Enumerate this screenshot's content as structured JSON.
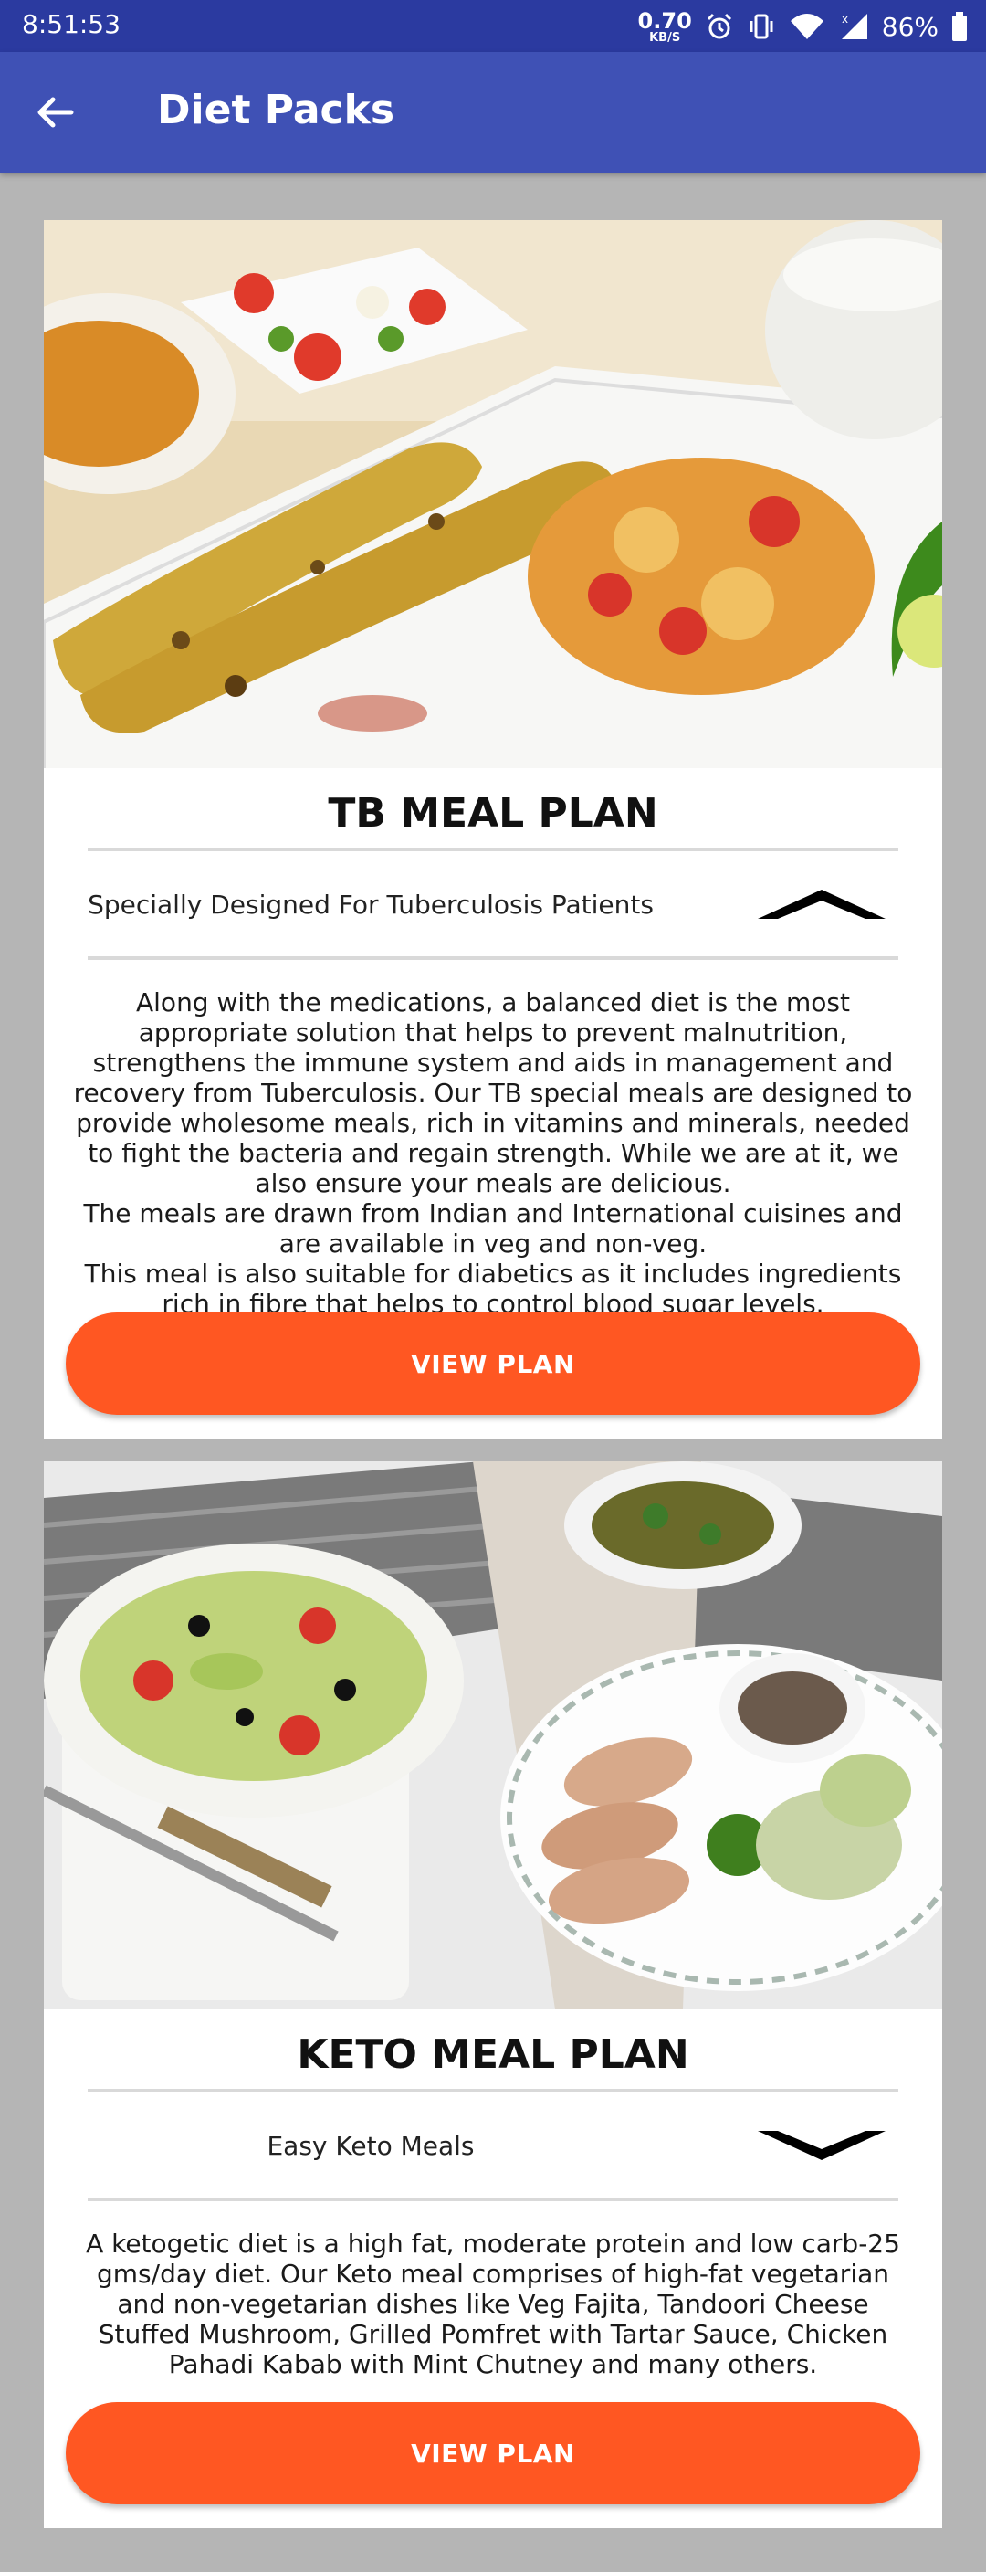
{
  "status_bar": {
    "time": "8:51:53",
    "net_speed_value": "0.70",
    "net_speed_unit": "KB/S",
    "battery": "86%",
    "icons": [
      "alarm-icon",
      "vibrate-icon",
      "wifi-icon",
      "signal-icon",
      "battery-icon"
    ]
  },
  "app_bar": {
    "title": "Diet Packs",
    "back_icon": "arrow-left-icon",
    "color": "#3f51b5"
  },
  "colors": {
    "status_bar": "#2b3aa0",
    "accent_button": "#ff5722",
    "background": "#b5b5b5"
  },
  "plans": [
    {
      "title": "TB MEAL PLAN",
      "subtitle": "Specially Designed For Tuberculosis Patients",
      "expanded": true,
      "toggle_icon": "chevron-up-icon",
      "description": [
        "Along with the medications, a balanced diet is the most appropriate solution that helps to prevent malnutrition, strengthens the immune system and aids in management and recovery from Tuberculosis. Our TB special meals are designed to provide wholesome meals, rich in vitamins and minerals, needed to fight the bacteria and regain strength. While we are at it, we also ensure your meals are delicious.",
        "The meals are drawn from Indian and International cuisines and are available in veg and non-veg.",
        "This meal is also suitable for diabetics as it includes ingredients rich in fibre that helps to control blood sugar levels."
      ],
      "button_label": "VIEW PLAN"
    },
    {
      "title": "KETO MEAL PLAN",
      "subtitle": "Easy Keto Meals",
      "expanded": false,
      "toggle_icon": "chevron-down-icon",
      "description": [
        "A ketogetic diet is a high fat, moderate protein and low carb-25 gms/day diet. Our Keto meal comprises of high-fat vegetarian and non-vegetarian dishes like Veg Fajita, Tandoori Cheese Stuffed Mushroom, Grilled Pomfret with Tartar Sauce, Chicken Pahadi Kabab with Mint Chutney and many others."
      ],
      "button_label": "VIEW PLAN"
    }
  ]
}
